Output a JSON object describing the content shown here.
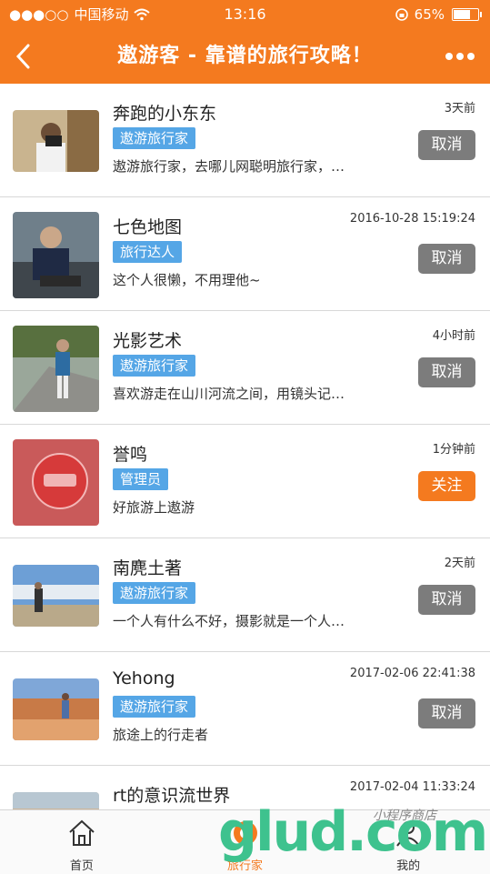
{
  "status": {
    "carrier": "中国移动",
    "time": "13:16",
    "battery": "65%",
    "battery_level": 0.65
  },
  "nav": {
    "back_icon": "chevron-left-icon",
    "title": "遨游客 - 靠谱的旅行攻略！",
    "more_icon": "ellipsis-icon"
  },
  "list": [
    {
      "name": "奔跑的小东东",
      "tag": "遨游旅行家",
      "bio": "遨游旅行家，去哪儿网聪明旅行家，…",
      "time": "3天前",
      "action": "取消"
    },
    {
      "name": "七色地图",
      "tag": "旅行达人",
      "bio": "这个人很懒，不用理他~",
      "time": "2016-10-28 15:19:24",
      "action": "取消"
    },
    {
      "name": "光影艺术",
      "tag": "遨游旅行家",
      "bio": "喜欢游走在山川河流之间，用镜头记…",
      "time": "4小时前",
      "action": "取消"
    },
    {
      "name": "誉鸣",
      "tag": "管理员",
      "bio": "好旅游上遨游",
      "time": "1分钟前",
      "action": "关注"
    },
    {
      "name": "南麂土著",
      "tag": "遨游旅行家",
      "bio": "一个人有什么不好，摄影就是一个人…",
      "time": "2天前",
      "action": "取消"
    },
    {
      "name": "Yehong",
      "tag": "遨游旅行家",
      "bio": "旅途上的行走者",
      "time": "2017-02-06 22:41:38",
      "action": "取消"
    },
    {
      "name": "rt的意识流世界",
      "tag": "",
      "bio": "",
      "time": "2017-02-04 11:33:24",
      "action": ""
    }
  ],
  "tabbar": {
    "tabs": [
      {
        "label": "首页",
        "icon": "home-icon"
      },
      {
        "label": "旅行家",
        "icon": "traveler-icon"
      },
      {
        "label": "我的",
        "icon": "user-icon"
      }
    ]
  },
  "watermark": {
    "main": "glud.com",
    "sub": "小程序商店"
  },
  "colors": {
    "accent": "#f47a1f",
    "tag": "#55a6e6",
    "cancel": "#7c7c7c"
  }
}
